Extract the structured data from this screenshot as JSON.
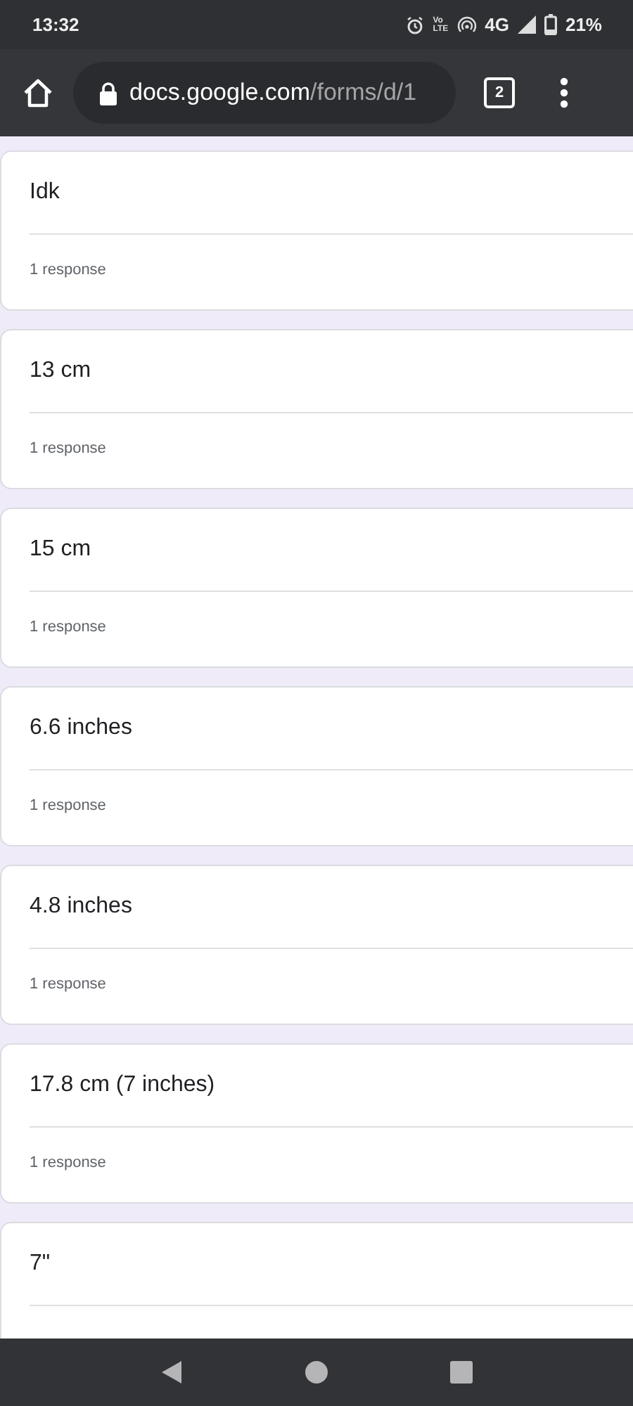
{
  "status_bar": {
    "time": "13:32",
    "volte": [
      "Vo",
      "LTE"
    ],
    "network": "4G",
    "battery": "21%"
  },
  "toolbar": {
    "url_host": "docs.google.com",
    "url_path": "/forms/d/1",
    "tab_count": "2"
  },
  "answers": [
    {
      "text": "Idk",
      "count": "1 response"
    },
    {
      "text": "13 cm",
      "count": "1 response"
    },
    {
      "text": "15 cm",
      "count": "1 response"
    },
    {
      "text": "6.6 inches",
      "count": "1 response"
    },
    {
      "text": "4.8 inches",
      "count": "1 response"
    },
    {
      "text": "17.8 cm (7 inches)",
      "count": "1 response"
    },
    {
      "text": "7\""
    }
  ]
}
